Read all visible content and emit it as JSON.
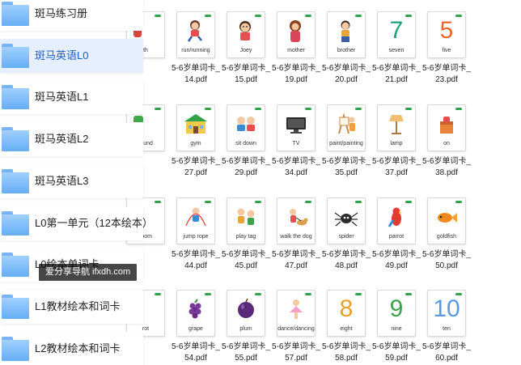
{
  "folders": [
    {
      "label": "斑马练习册",
      "selected": false
    },
    {
      "label": "斑马英语L0",
      "selected": true
    },
    {
      "label": "斑马英语L1",
      "selected": false
    },
    {
      "label": "斑马英语L2",
      "selected": false
    },
    {
      "label": "斑马英语L3",
      "selected": false
    },
    {
      "label": "L0第一单元（12本绘本）",
      "selected": false
    },
    {
      "label": "L0绘本单词卡",
      "selected": false
    },
    {
      "label": "L1教材绘本和词卡",
      "selected": false
    },
    {
      "label": "L2教材绘本和词卡",
      "selected": false
    }
  ],
  "watermark": "爱分享导航 ifxdh.com",
  "colors": {
    "selected_row": "#e5efff",
    "folder_blue": "#66aef4",
    "card_tag": "#2fa24a"
  },
  "file_rows": [
    {
      "cards": [
        {
          "word": "th",
          "icon": "partial-red",
          "name": ""
        },
        {
          "word": "run/running",
          "icon": "girl-running",
          "name": "5-6岁单词卡_14.pdf"
        },
        {
          "word": "Joey",
          "icon": "boy-face",
          "name": "5-6岁单词卡_15.pdf"
        },
        {
          "word": "mother",
          "icon": "mother-figure",
          "name": "5-6岁单词卡_19.pdf"
        },
        {
          "word": "brother",
          "icon": "boy-figure",
          "name": "5-6岁单词卡_20.pdf"
        },
        {
          "word": "seven",
          "icon": "digit",
          "digit": "7",
          "digit_color": "#1aa37a",
          "name": "5-6岁单词卡_21.pdf"
        },
        {
          "word": "five",
          "icon": "digit",
          "digit": "5",
          "digit_color": "#e8672b",
          "name": "5-6岁单词卡_23.pdf"
        }
      ],
      "partial_name": "th"
    },
    {
      "cards": [
        {
          "word": "round",
          "icon": "partial-green",
          "name": ""
        },
        {
          "word": "gym",
          "icon": "gym-building",
          "name": "5-6岁单词卡_27.pdf"
        },
        {
          "word": "sit down",
          "icon": "kids-sitting",
          "name": "5-6岁单词卡_29.pdf"
        },
        {
          "word": "TV",
          "icon": "tv-set",
          "name": "5-6岁单词卡_34.pdf"
        },
        {
          "word": "paint/painting",
          "icon": "easel-painter",
          "name": "5-6岁单词卡_35.pdf"
        },
        {
          "word": "lamp",
          "icon": "floor-lamp",
          "name": "5-6岁单词卡_37.pdf"
        },
        {
          "word": "on",
          "icon": "box-on",
          "name": "5-6岁单词卡_38.pdf"
        }
      ],
      "partial_name": "卡_"
    },
    {
      "cards": [
        {
          "word": "room",
          "icon": "partial-orange",
          "name": ""
        },
        {
          "word": "jump rope",
          "icon": "kid-jumping",
          "name": "5-6岁单词卡_44.pdf"
        },
        {
          "word": "play tag",
          "icon": "kids-playing",
          "name": "5-6岁单词卡_45.pdf"
        },
        {
          "word": "walk the dog",
          "icon": "kid-dog",
          "name": "5-6岁单词卡_47.pdf"
        },
        {
          "word": "spider",
          "icon": "spider",
          "name": "5-6岁单词卡_48.pdf"
        },
        {
          "word": "parrot",
          "icon": "parrot",
          "name": "5-6岁单词卡_49.pdf"
        },
        {
          "word": "goldfish",
          "icon": "goldfish",
          "name": "5-6岁单词卡_50.pdf"
        }
      ],
      "partial_name": "卡_"
    },
    {
      "cards": [
        {
          "word": "rot",
          "icon": "partial-red",
          "name": ""
        },
        {
          "word": "grape",
          "icon": "grapes",
          "name": "5-6岁单词卡_54.pdf"
        },
        {
          "word": "plum",
          "icon": "plum",
          "name": "5-6岁单词卡_55.pdf"
        },
        {
          "word": "dance/dancing",
          "icon": "ballerina",
          "name": "5-6岁单词卡_57.pdf"
        },
        {
          "word": "eight",
          "icon": "digit",
          "digit": "8",
          "digit_color": "#e8a02b",
          "name": "5-6岁单词卡_58.pdf"
        },
        {
          "word": "nine",
          "icon": "digit",
          "digit": "9",
          "digit_color": "#3aa34a",
          "name": "5-6岁单词卡_59.pdf"
        },
        {
          "word": "ten",
          "icon": "digit",
          "digit": "10",
          "digit_color": "#5a9be0",
          "name": "5-6岁单词卡_60.pdf"
        }
      ],
      "partial_name": "卡_"
    }
  ]
}
